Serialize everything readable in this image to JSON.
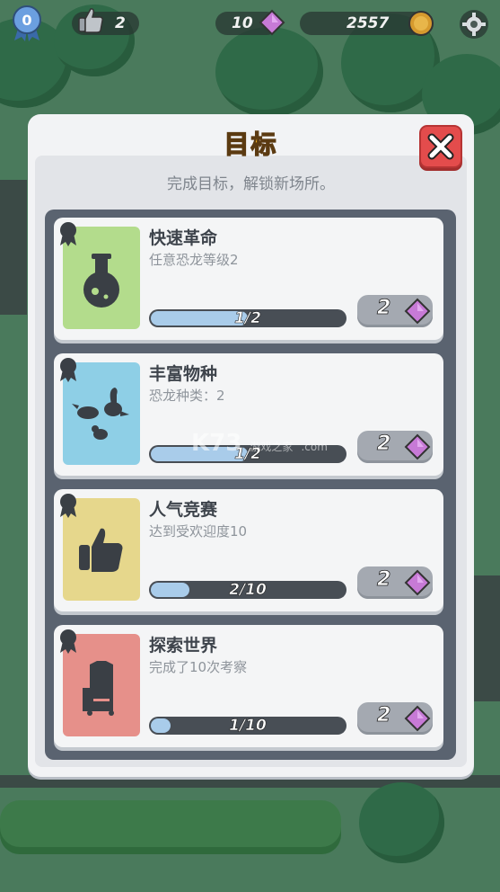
{
  "hud": {
    "level": "0",
    "likes": "2",
    "gems": "10",
    "coins": "2557"
  },
  "panel": {
    "title": "目标",
    "subtitle": "完成目标，解锁新场所。"
  },
  "goals": [
    {
      "title": "快速革命",
      "desc": "任意恐龙等级2",
      "progress_text": "1/2",
      "progress": 0.5,
      "reward": "2",
      "card_color": "#b3dc8c",
      "icon": "flask-icon"
    },
    {
      "title": "丰富物种",
      "desc": "恐龙种类：2",
      "progress_text": "1/2",
      "progress": 0.5,
      "reward": "2",
      "card_color": "#8ecfe6",
      "icon": "dinosaurs-icon"
    },
    {
      "title": "人气竞赛",
      "desc": "达到受欢迎度10",
      "progress_text": "2/10",
      "progress": 0.2,
      "reward": "2",
      "card_color": "#e6d78c",
      "icon": "thumbs-up-icon"
    },
    {
      "title": "探索世界",
      "desc": "完成了10次考察",
      "progress_text": "1/10",
      "progress": 0.1,
      "reward": "2",
      "card_color": "#e6908a",
      "icon": "explorer-bag-icon"
    }
  ],
  "watermark": {
    "logo": "K73",
    "tagline": "游戏之家",
    "domain": ".com"
  },
  "colors": {
    "title": "#f5b51e",
    "gem": "#c77ad6",
    "close": "#e34c4c"
  }
}
